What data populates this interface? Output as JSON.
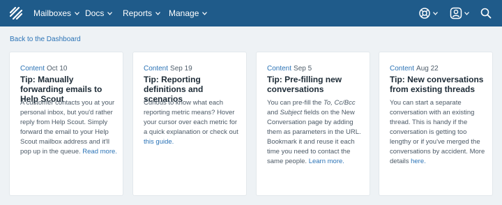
{
  "nav": {
    "items": [
      {
        "label": "Mailboxes"
      },
      {
        "label": "Docs"
      },
      {
        "label": "Reports"
      },
      {
        "label": "Manage"
      }
    ]
  },
  "icons": {
    "logo": "helpscout-logo-icon",
    "help": "help-lifebuoy-icon",
    "profile": "user-profile-icon",
    "search": "search-icon",
    "chevron": "chevron-down-icon"
  },
  "colors": {
    "topbar": "#1f5b8a",
    "link": "#2b73b6",
    "background": "#eef2f5"
  },
  "back_link": "Back to the Dashboard",
  "cards": [
    {
      "tag": "Content",
      "date": "Oct 10",
      "title": "Tip: Manually forwarding emails to Help Scout",
      "body": "A customer contacts you at your personal inbox, but you'd rather reply from Help Scout. Simply forward the email to your Help Scout mailbox address and it'll pop up in the queue.",
      "link": "Read more."
    },
    {
      "tag": "Content",
      "date": "Sep 19",
      "title": "Tip: Reporting definitions and scenarios",
      "body": "Curious to know what each reporting metric means? Hover your cursor over each metric for a quick explanation or check out",
      "link": "this guide."
    },
    {
      "tag": "Content",
      "date": "Sep 5",
      "title": "Tip: Pre-filling new conversations",
      "body_pre": "You can pre-fill the",
      "body_em1": "To, Cc/Bcc",
      "body_mid": "and",
      "body_em2": "Subject",
      "body_post": "fields on the New Conversation page by adding them as parameters in the URL. Bookmark it and reuse it each time you need to contact the same people.",
      "link": "Learn more."
    },
    {
      "tag": "Content",
      "date": "Aug 22",
      "title": "Tip: New conversations from existing threads",
      "body": "You can start a separate conversation with an existing thread. This is handy if the conversation is getting too lengthy or if you've merged the conversations by accident. More details",
      "link": "here."
    }
  ]
}
